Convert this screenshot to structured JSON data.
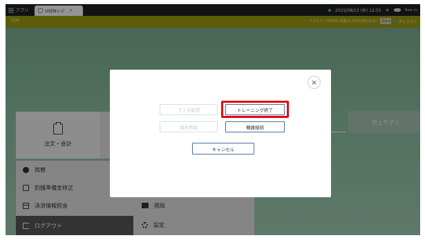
{
  "taskbar": {
    "apps_label": "アプリ",
    "tab_title": "USENレジ",
    "tab_close": "×",
    "datetime": "2025/08/13 (水) 12:55",
    "tray_note": "New co"
  },
  "header": {
    "title": "TOP",
    "user_info": "テストユーザ0001 営業日:2025/08/13(水)",
    "lang_label": "文A",
    "status": "オンライン"
  },
  "main": {
    "order_tile_label": "注文・会計",
    "summary_label": "売上サマリ",
    "menu_items": [
      {
        "label": "両替"
      },
      {
        "label": "釣銭準備金修正"
      },
      {
        "label": "決済情報照会"
      },
      {
        "label": "ログアウト"
      }
    ],
    "menu2_items": [
      {
        "label": "閉局"
      },
      {
        "label": "設定"
      }
    ]
  },
  "modal": {
    "close_glyph": "×",
    "buttons": [
      {
        "label": "マスタ取得",
        "enabled": false
      },
      {
        "label": "トレーニング終了",
        "enabled": true
      },
      {
        "label": "端末情報",
        "enabled": false
      },
      {
        "label": "機器接続",
        "enabled": true
      },
      {
        "label": "キャンセル",
        "enabled": true
      }
    ]
  },
  "colors": {
    "header_bar": "#a19f11",
    "highlight": "#e8000b",
    "button_border": "#4a6ea0"
  }
}
